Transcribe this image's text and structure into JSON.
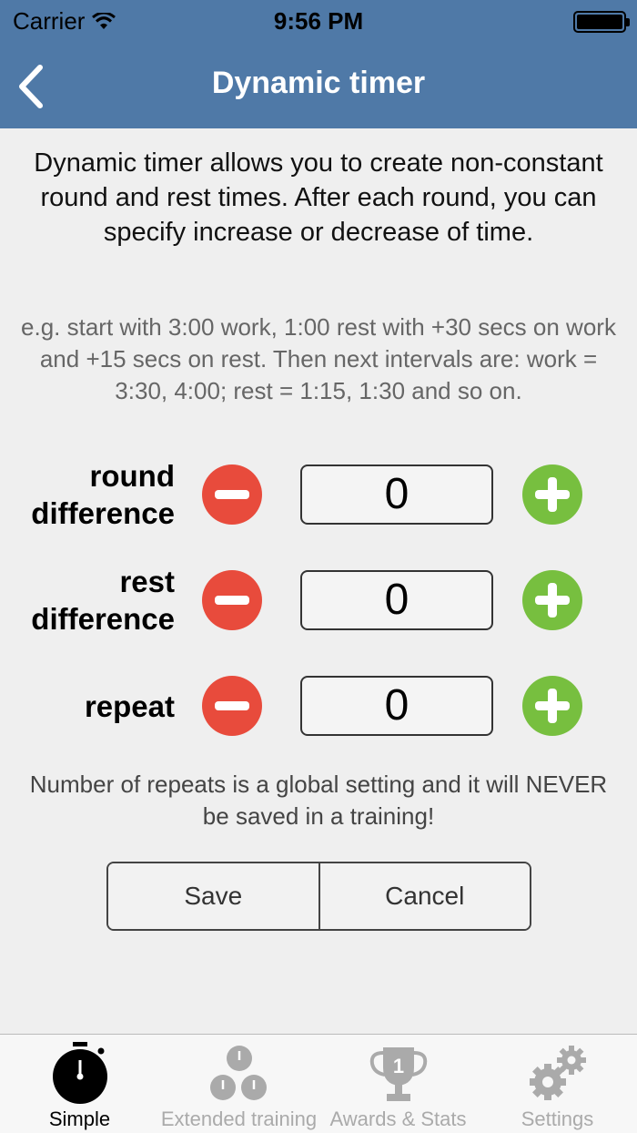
{
  "status_bar": {
    "carrier": "Carrier",
    "time": "9:56 PM"
  },
  "nav": {
    "title": "Dynamic timer"
  },
  "intro": "Dynamic timer allows you to create non-constant round and rest times. After each round, you can specify increase or decrease of time.",
  "example": "e.g. start with 3:00 work, 1:00 rest with +30 secs on work and +15 secs on rest. Then next intervals are: work = 3:30, 4:00; rest = 1:15, 1:30 and so on.",
  "rows": [
    {
      "label_line1": "round",
      "label_line2": "difference",
      "value": "0"
    },
    {
      "label_line1": "rest",
      "label_line2": "difference",
      "value": "0"
    },
    {
      "label_line1": "repeat",
      "label_line2": "",
      "value": "0"
    }
  ],
  "note": "Number of repeats is a global setting and it will NEVER be saved in a training!",
  "buttons": {
    "save": "Save",
    "cancel": "Cancel"
  },
  "tabs": [
    {
      "label": "Simple",
      "icon": "stopwatch-icon",
      "active": true
    },
    {
      "label": "Extended training",
      "icon": "multi-stopwatch-icon",
      "active": false
    },
    {
      "label": "Awards & Stats",
      "icon": "trophy-icon",
      "active": false,
      "badge": "1"
    },
    {
      "label": "Settings",
      "icon": "gears-icon",
      "active": false
    }
  ],
  "colors": {
    "header": "#4f79a7",
    "minus": "#e84b3c",
    "plus": "#77bf3f",
    "tab_inactive": "#aaaaaa"
  }
}
